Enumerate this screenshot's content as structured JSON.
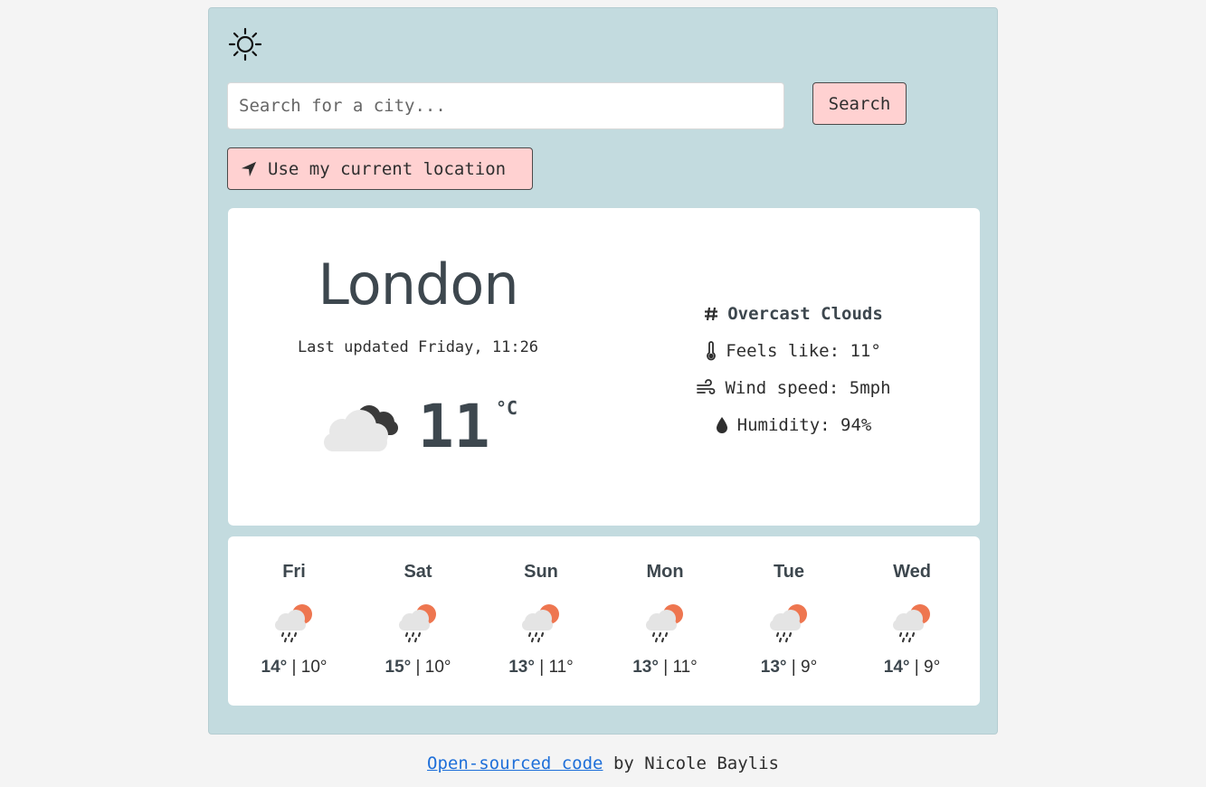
{
  "search": {
    "placeholder": "Search for a city...",
    "button_label": "Search"
  },
  "location_button": {
    "label": "Use my current location"
  },
  "current": {
    "city": "London",
    "updated": "Last updated Friday, 11:26",
    "temperature": "11",
    "unit": "°C",
    "description": "Overcast Clouds",
    "feels_like": "Feels like: 11°",
    "wind": "Wind speed: 5mph",
    "humidity": "Humidity: 94%",
    "icon": "partly-cloudy-icon"
  },
  "forecast": [
    {
      "day": "Fri",
      "max": "14°",
      "min": "10°",
      "icon": "sun-rain-icon"
    },
    {
      "day": "Sat",
      "max": "15°",
      "min": "10°",
      "icon": "sun-rain-icon"
    },
    {
      "day": "Sun",
      "max": "13°",
      "min": "11°",
      "icon": "sun-rain-icon"
    },
    {
      "day": "Mon",
      "max": "13°",
      "min": "11°",
      "icon": "sun-rain-icon"
    },
    {
      "day": "Tue",
      "max": "13°",
      "min": "9°",
      "icon": "sun-rain-icon"
    },
    {
      "day": "Wed",
      "max": "14°",
      "min": "9°",
      "icon": "sun-rain-icon"
    }
  ],
  "footer": {
    "link_text": "Open-sourced code",
    "by_text": " by Nicole Baylis"
  },
  "colors": {
    "panel": "#c3dbdf",
    "button": "#ffd1d1",
    "sun": "#ee7650",
    "link": "#1e6fd9"
  }
}
